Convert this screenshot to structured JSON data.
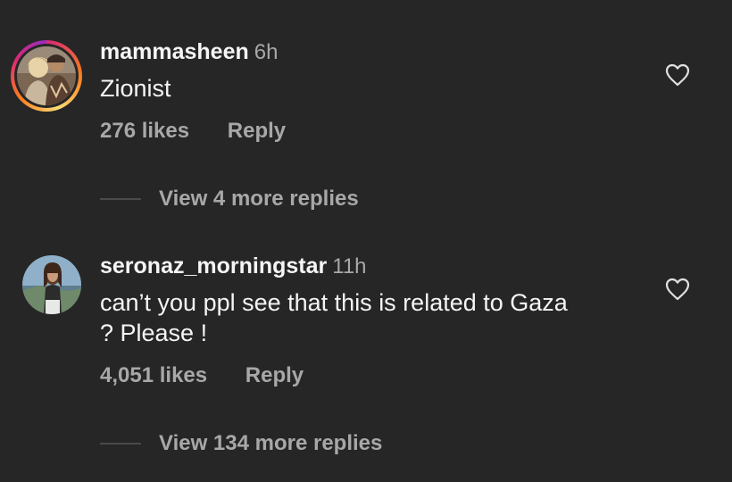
{
  "comments": [
    {
      "username": "mammasheen",
      "time": "6h",
      "text_lines": [
        "Zionist"
      ],
      "likes": "276 likes",
      "reply_label": "Reply",
      "view_replies": "View 4 more replies",
      "avatar_style": "story-ring",
      "heart_icon": "heart-outline-icon"
    },
    {
      "username": "seronaz_morningstar",
      "time": "11h",
      "text_lines": [
        "can’t you ppl see that this is related to Gaza",
        "? Please !"
      ],
      "likes": "4,051 likes",
      "reply_label": "Reply",
      "view_replies": "View 134 more replies",
      "avatar_style": "plain",
      "heart_icon": "heart-outline-icon"
    }
  ],
  "colors": {
    "background": "#262626",
    "primary_text": "#f5f5f5",
    "secondary_text": "#a8a8a8",
    "divider": "#4a4a4a",
    "story_ring_start": "#d62976",
    "story_ring_end": "#feda75"
  }
}
